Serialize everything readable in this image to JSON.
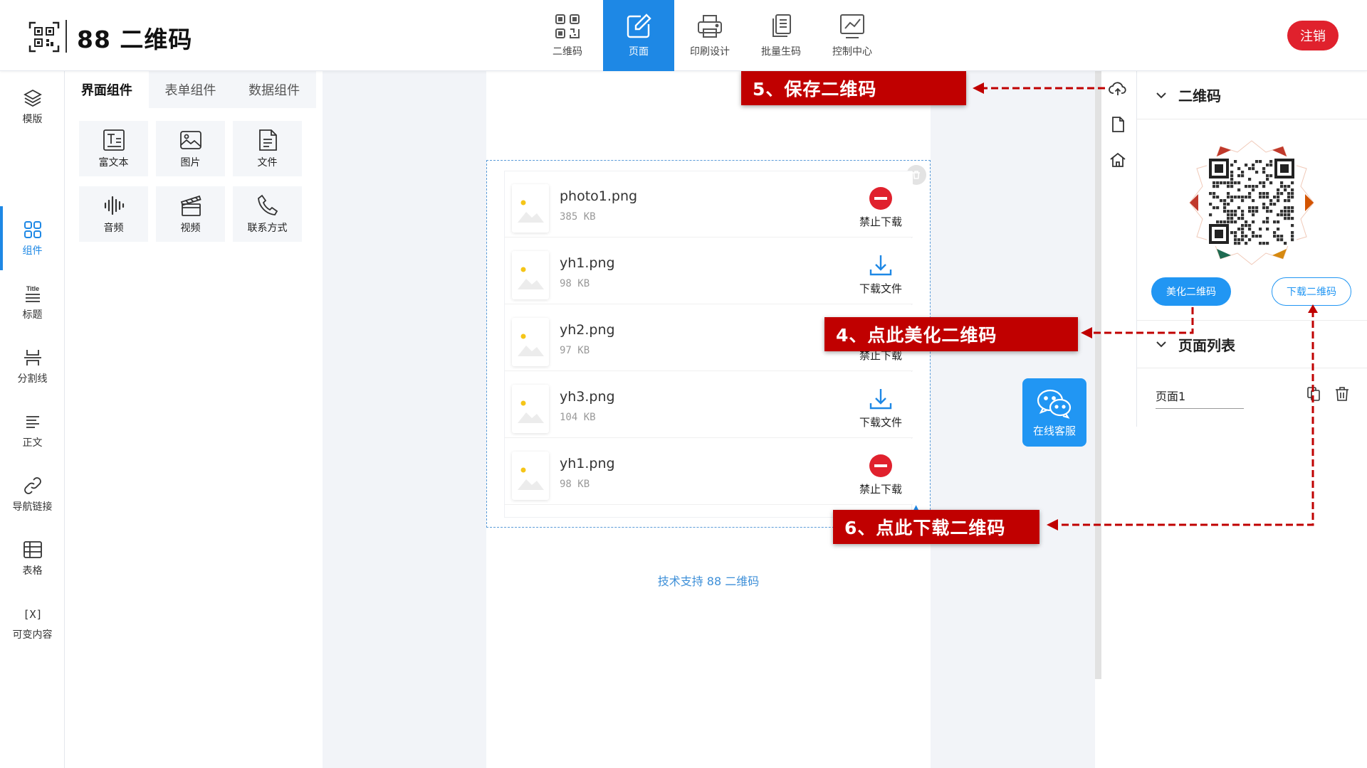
{
  "header": {
    "brand": "88 二维码",
    "logout_label": "注销",
    "nav": [
      {
        "label": "二维码",
        "icon": "qrcode-icon"
      },
      {
        "label": "页面",
        "icon": "edit-page-icon"
      },
      {
        "label": "印刷设计",
        "icon": "printer-icon"
      },
      {
        "label": "批量生码",
        "icon": "batch-docs-icon"
      },
      {
        "label": "控制中心",
        "icon": "chart-icon"
      }
    ],
    "active_nav": "页面"
  },
  "sidebar": {
    "items": [
      {
        "label": "模版",
        "icon": "layers-icon"
      },
      {
        "label": "组件",
        "icon": "grid-icon"
      },
      {
        "label": "标题",
        "icon": "title-icon",
        "icon_text": "Title"
      },
      {
        "label": "分割线",
        "icon": "divider-icon"
      },
      {
        "label": "正文",
        "icon": "paragraph-icon"
      },
      {
        "label": "导航链接",
        "icon": "link-icon"
      },
      {
        "label": "表格",
        "icon": "table-icon"
      },
      {
        "label": "可变内容",
        "icon": "variable-icon",
        "icon_text": "[X]"
      }
    ],
    "active": "组件"
  },
  "components": {
    "tabs": [
      "界面组件",
      "表单组件",
      "数据组件"
    ],
    "active_tab": "界面组件",
    "items": [
      {
        "label": "富文本",
        "icon": "richtext-icon"
      },
      {
        "label": "图片",
        "icon": "image-icon"
      },
      {
        "label": "文件",
        "icon": "file-icon"
      },
      {
        "label": "音频",
        "icon": "audio-icon"
      },
      {
        "label": "视频",
        "icon": "video-icon"
      },
      {
        "label": "联系方式",
        "icon": "phone-icon"
      }
    ]
  },
  "files": [
    {
      "name": "photo1.png",
      "size": "385 KB",
      "action": "禁止下载",
      "action_type": "forbid"
    },
    {
      "name": "yh1.png",
      "size": "98 KB",
      "action": "下载文件",
      "action_type": "download"
    },
    {
      "name": "yh2.png",
      "size": "97 KB",
      "action": "禁止下载",
      "action_type": "forbid"
    },
    {
      "name": "yh3.png",
      "size": "104 KB",
      "action": "下载文件",
      "action_type": "download"
    },
    {
      "name": "yh1.png",
      "size": "98 KB",
      "action": "禁止下载",
      "action_type": "forbid"
    }
  ],
  "canvas": {
    "tech_support": "技术支持 88 二维码"
  },
  "chat": {
    "label": "在线客服"
  },
  "right_panel": {
    "qr_section_title": "二维码",
    "beautify_label": "美化二维码",
    "download_label": "下载二维码",
    "page_list_title": "页面列表",
    "pages": [
      "页面1"
    ]
  },
  "annotations": {
    "step5": "5、保存二维码",
    "step4": "4、点此美化二维码",
    "step6": "6、点此下载二维码"
  },
  "colors": {
    "accent": "#1e88e5",
    "logout": "#e0212d",
    "callout": "#c00000",
    "forbid": "#e0212d"
  }
}
